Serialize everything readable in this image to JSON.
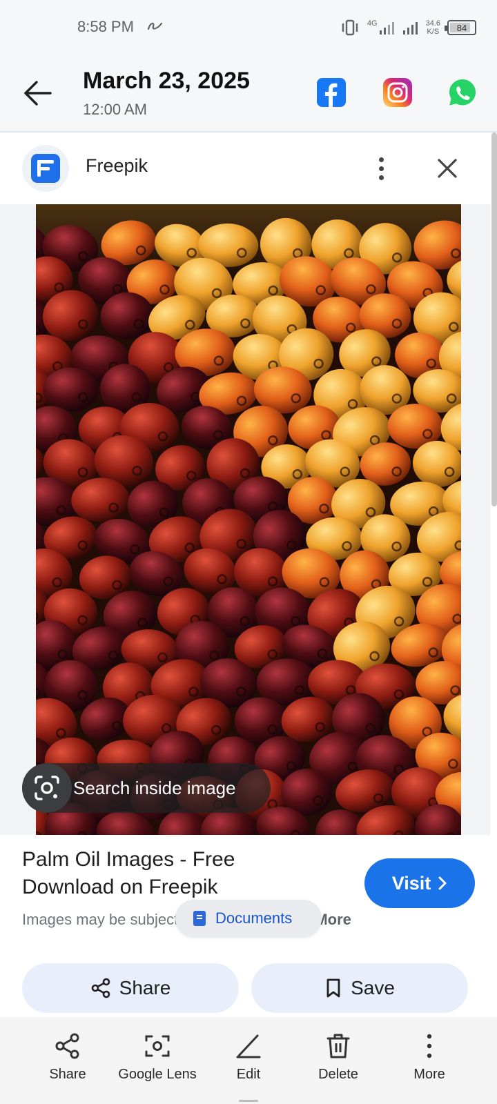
{
  "status_bar": {
    "time": "8:58 PM",
    "network": "4G",
    "speed_value": "34.6",
    "speed_unit": "K/S",
    "battery": "84",
    "battery_level": 0.84
  },
  "header": {
    "date": "March 23, 2025",
    "time": "12:00 AM",
    "social": [
      {
        "name": "facebook-icon",
        "color": "#1877f2"
      },
      {
        "name": "instagram-icon",
        "color": "#e4405f"
      },
      {
        "name": "whatsapp-icon",
        "color": "#25d366"
      }
    ]
  },
  "lens": {
    "source_name": "Freepik",
    "search_inside": "Search inside image",
    "result_title": "Palm Oil Images - Free Download on Freepik",
    "visit_label": "Visit",
    "disclaimer_text": "Images may be subject to copyright.",
    "learn_more": "Learn More",
    "documents_chip": "Documents",
    "share_label": "Share",
    "save_label": "Save",
    "accent_color": "#1a73e8"
  },
  "toolbar": {
    "items": [
      {
        "label": "Share",
        "icon": "share-icon"
      },
      {
        "label": "Google Lens",
        "icon": "lens-icon"
      },
      {
        "label": "Edit",
        "icon": "edit-icon"
      },
      {
        "label": "Delete",
        "icon": "delete-icon"
      },
      {
        "label": "More",
        "icon": "more-icon"
      }
    ]
  }
}
